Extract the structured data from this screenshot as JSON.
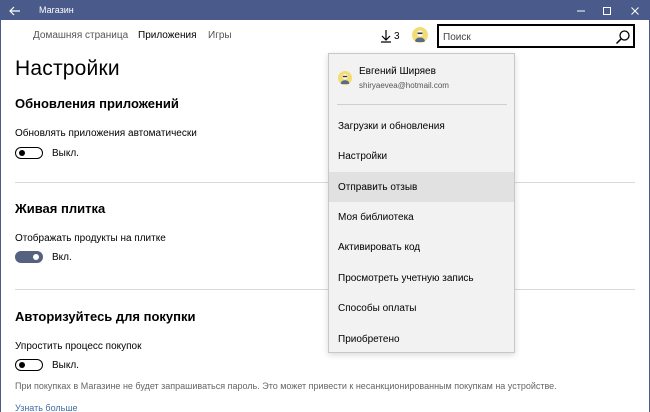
{
  "window": {
    "title": "Магазин"
  },
  "nav": {
    "home": "Домашняя страница",
    "apps": "Приложения",
    "games": "Игры"
  },
  "downloads": {
    "count": "3"
  },
  "search": {
    "placeholder": "Поиск"
  },
  "page": {
    "title": "Настройки"
  },
  "sections": {
    "updates": {
      "title": "Обновления приложений",
      "label": "Обновлять приложения автоматически",
      "state": "Выкл."
    },
    "tile": {
      "title": "Живая плитка",
      "label": "Отображать продукты на плитке",
      "state": "Вкл."
    },
    "purchase": {
      "title": "Авторизуйтесь для покупки",
      "label": "Упростить процесс покупок",
      "state": "Выкл.",
      "note": "При покупках в Магазине не будет запрашиваться пароль. Это может привести к несанкционированным покупкам на устройстве.",
      "link": "Узнать больше"
    }
  },
  "account_menu": {
    "name": "Евгений Ширяев",
    "email": "shiryaevea@hotmail.com",
    "items": [
      "Загрузки и обновления",
      "Настройки",
      "Отправить отзыв",
      "Моя библиотека",
      "Активировать код",
      "Просмотреть учетную запись",
      "Способы оплаты",
      "Приобретено"
    ],
    "hovered_index": 2
  },
  "colors": {
    "titlebar": "#4a5a8a",
    "toggle_on": "#56607f",
    "link": "#3f6ea8",
    "avatar": "#f3dc73"
  }
}
